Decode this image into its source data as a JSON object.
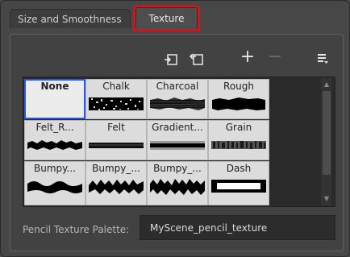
{
  "tabs": [
    {
      "label": "Size and Smoothness"
    },
    {
      "label": "Texture"
    }
  ],
  "toolbar": {
    "import_icon": "import-texture-icon",
    "export_icon": "export-texture-icon",
    "add_label": "+",
    "remove_label": "−",
    "menu_icon": "menu-icon"
  },
  "textures": [
    {
      "label": "None"
    },
    {
      "label": "Chalk"
    },
    {
      "label": "Charcoal"
    },
    {
      "label": "Rough"
    },
    {
      "label": "Felt_R..."
    },
    {
      "label": "Felt"
    },
    {
      "label": "Gradient..."
    },
    {
      "label": "Grain"
    },
    {
      "label": "Bumpy..."
    },
    {
      "label": "Bumpy_..."
    },
    {
      "label": "Bumpy_..."
    },
    {
      "label": "Dash"
    }
  ],
  "palette": {
    "label": "Pencil Texture Palette:",
    "value": "MyScene_pencil_texture"
  },
  "colors": {
    "highlight": "#d0161b",
    "selection": "#2a57e0"
  }
}
